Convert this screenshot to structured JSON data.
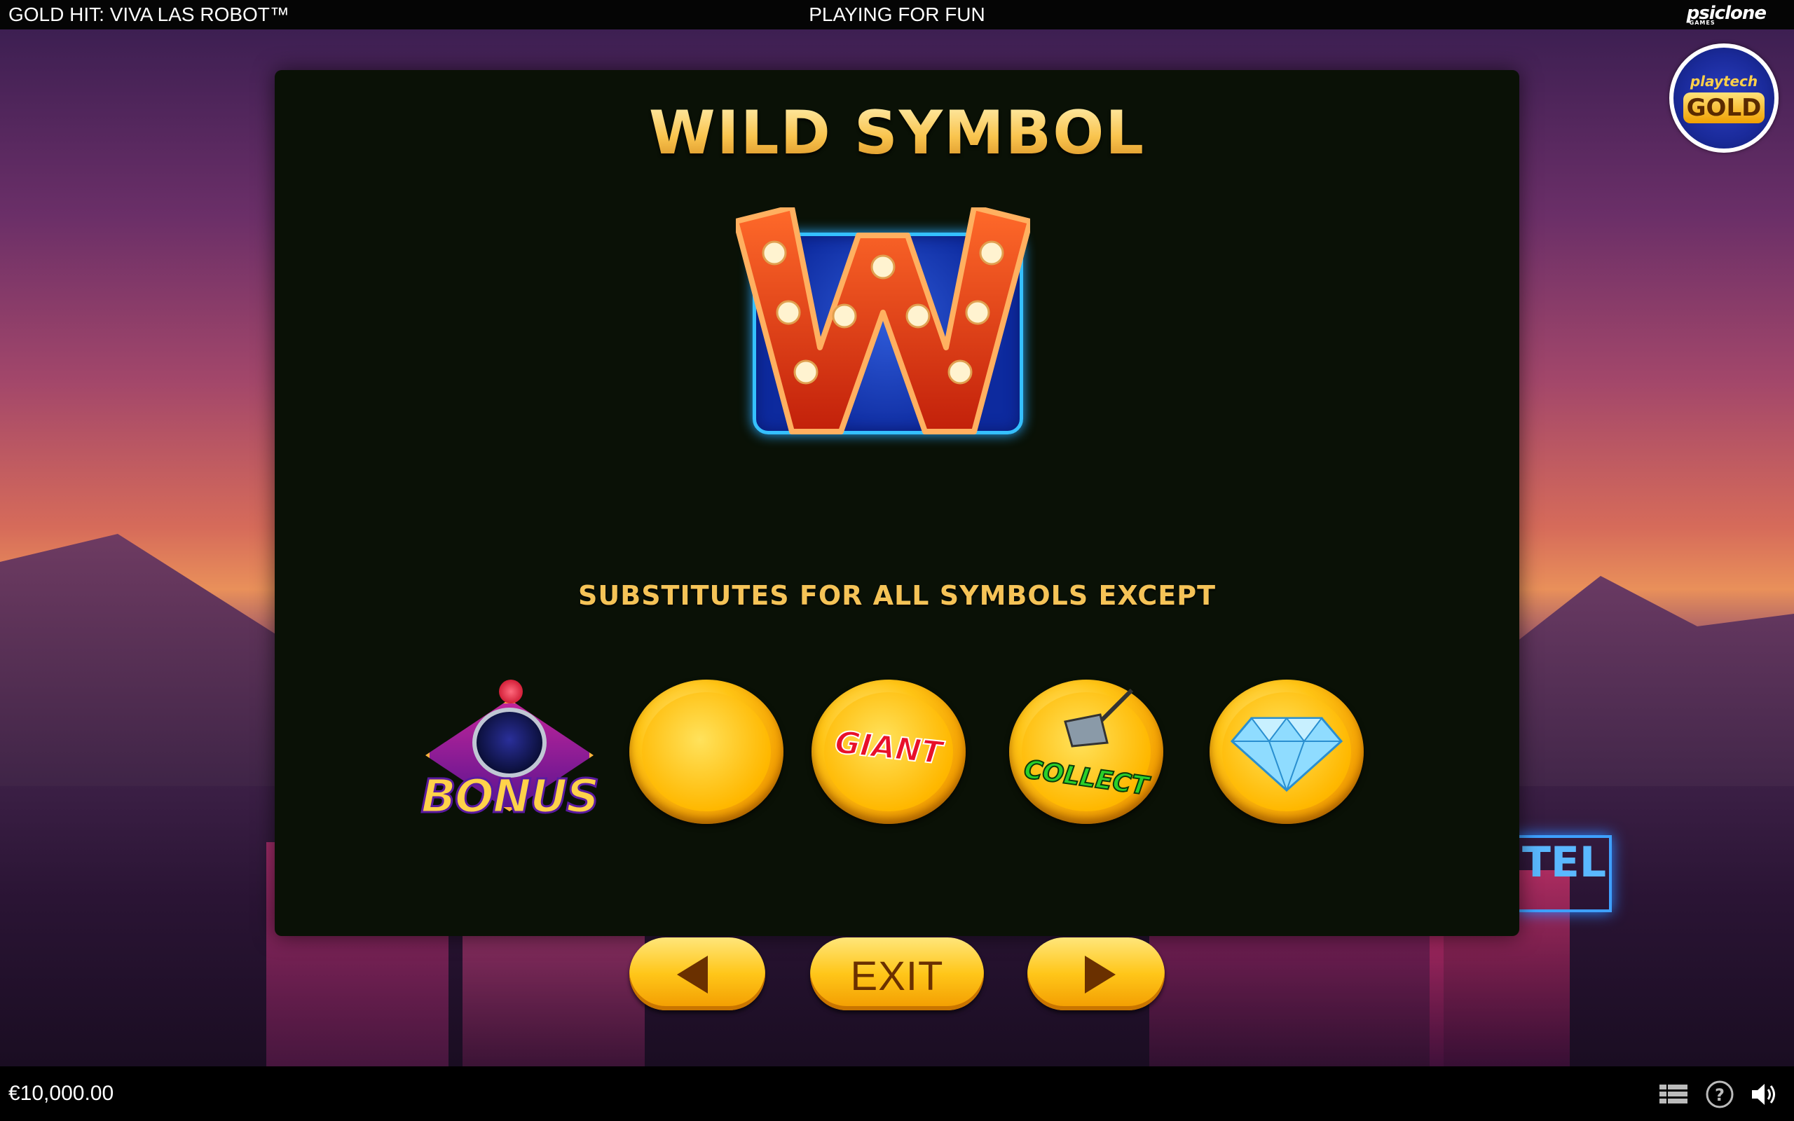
{
  "topbar": {
    "game_title": "GOLD HIT: VIVA LAS ROBOT™",
    "mode_label": "PLAYING FOR FUN",
    "provider_logo": "psiclone",
    "provider_sub": "GAMES"
  },
  "badge": {
    "top_text": "playtech",
    "main_text": "GOLD"
  },
  "panel": {
    "title": "WILD SYMBOL",
    "wild_icon": "W",
    "description": "SUBSTITUTES FOR ALL SYMBOLS EXCEPT",
    "symbols": [
      {
        "name": "bonus-symbol",
        "label": "BONUS"
      },
      {
        "name": "gold-coin-symbol",
        "label": ""
      },
      {
        "name": "giant-coin-symbol",
        "label": "GIANT"
      },
      {
        "name": "collect-coin-symbol",
        "label": "COLLECT"
      },
      {
        "name": "diamond-coin-symbol",
        "label": ""
      }
    ]
  },
  "nav": {
    "prev_icon": "arrow-left-icon",
    "exit_label": "EXIT",
    "next_icon": "arrow-right-icon"
  },
  "bottombar": {
    "balance": "€10,000.00",
    "icons": [
      "menu-icon",
      "help-icon",
      "sound-icon"
    ]
  },
  "colors": {
    "title_gold": "#f7c95a",
    "button_gold": "#ffc619",
    "panel_bg": "#0a1106",
    "wild_frame_blue": "#35c0ff"
  }
}
